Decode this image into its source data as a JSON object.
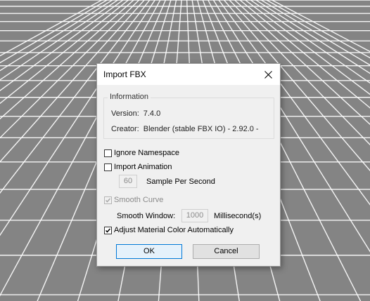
{
  "dialog": {
    "title": "Import FBX",
    "close_icon": "close-icon"
  },
  "information": {
    "legend": "Information",
    "version_label": "Version:",
    "version_value": "7.4.0",
    "creator_label": "Creator:",
    "creator_value": "Blender (stable FBX IO) - 2.92.0 -"
  },
  "options": {
    "ignore_namespace": {
      "label": "Ignore Namespace",
      "checked": false,
      "enabled": true
    },
    "import_animation": {
      "label": "Import Animation",
      "checked": false,
      "enabled": true
    },
    "sample_per_second": {
      "value": "60",
      "label": "Sample Per Second",
      "enabled": false
    },
    "smooth_curve": {
      "label": "Smooth Curve",
      "checked": true,
      "enabled": false
    },
    "smooth_window": {
      "label": "Smooth Window:",
      "value": "1000",
      "unit": "Millisecond(s)",
      "enabled": false
    },
    "adjust_material_color": {
      "label": "Adjust Material Color Automatically",
      "checked": true,
      "enabled": true
    }
  },
  "buttons": {
    "ok": "OK",
    "cancel": "Cancel"
  },
  "colors": {
    "viewport_bg": "#848484",
    "grid_line": "#ffffff",
    "dialog_bg": "#f0f0f0",
    "default_button_border": "#0078d7"
  }
}
